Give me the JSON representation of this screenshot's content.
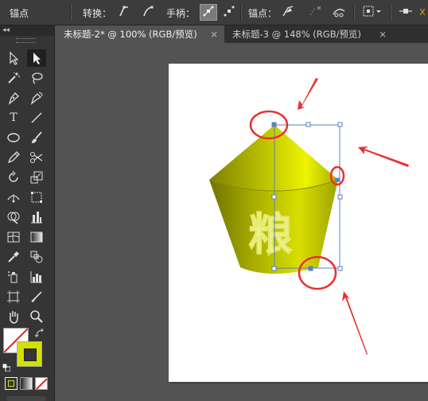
{
  "control_bar": {
    "anchor_title": "锚点",
    "convert_label": "转换：",
    "handle_label": "手柄：",
    "anchor_label": "锚点："
  },
  "tabs": [
    {
      "title": "未标题-2* @ 100% (RGB/预览)",
      "close": "×",
      "active": true
    },
    {
      "title": "未标题-3 @ 148% (RGB/预览)",
      "close": "×",
      "active": false
    }
  ],
  "toolbox": {
    "collapse_glyph": "◂◂",
    "type_tool_glyph": "T"
  },
  "artwork": {
    "text_glyph": "粮",
    "body_color": "#b9be00",
    "highlight_color": "#e9f000",
    "selection_color": "#5a7fc4",
    "annotation_color": "#e8312c"
  },
  "colors": {
    "fill_swatch": "#ffffff",
    "stroke_swatch": "#d4e000"
  }
}
